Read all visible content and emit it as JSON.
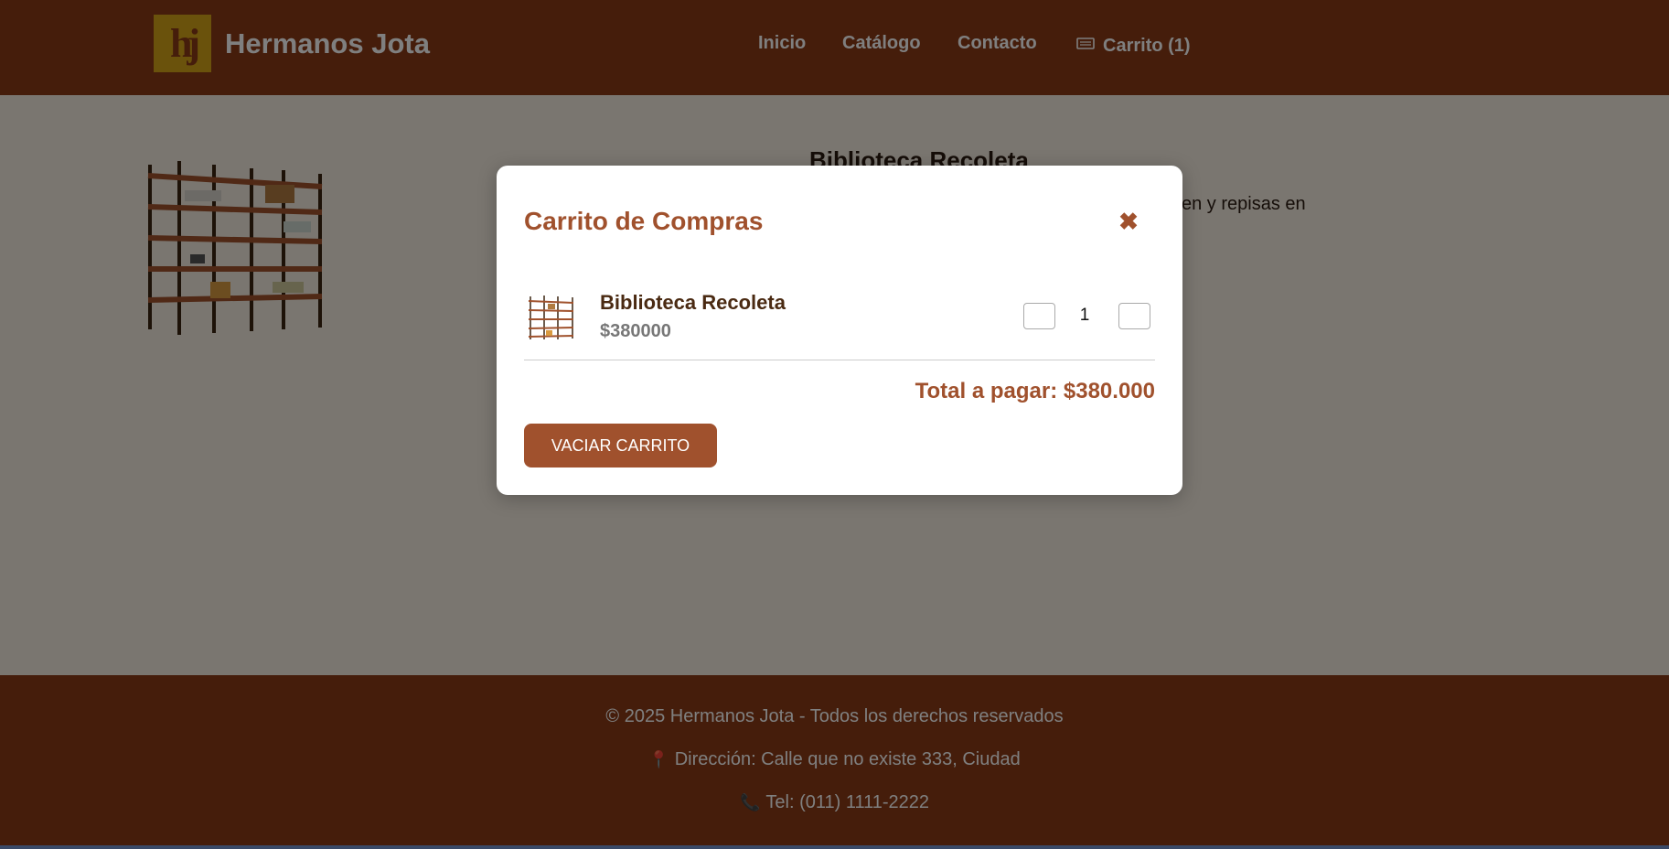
{
  "header": {
    "logo_text": "hj",
    "brand": "Hermanos Jota",
    "nav": {
      "home": "Inicio",
      "catalog": "Catálogo",
      "contact": "Contacto",
      "cart": "Carrito (1)"
    }
  },
  "product": {
    "title": "Biblioteca Recoleta",
    "description_partial": "en y repisas en"
  },
  "cart_modal": {
    "title": "Carrito de Compras",
    "close_symbol": "✖",
    "item": {
      "name": "Biblioteca Recoleta",
      "price": "$380000",
      "quantity": "1"
    },
    "total": "Total a pagar: $380.000",
    "empty_button": "VACIAR CARRITO"
  },
  "footer": {
    "copyright": "© 2025 Hermanos Jota - Todos los derechos reservados",
    "address": "Dirección: Calle que no existe 333, Ciudad",
    "phone": "Tel: (011) 1111-2222"
  },
  "colors": {
    "brand_brown": "#8a3b17",
    "accent": "#a0512d",
    "logo_gold": "#d4a419",
    "page_bg": "#f5ede1"
  }
}
